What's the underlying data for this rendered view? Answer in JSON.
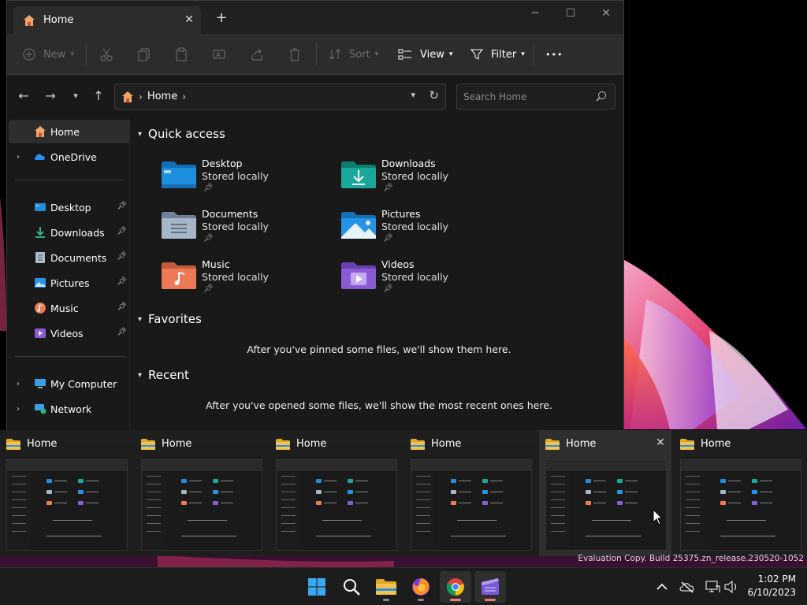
{
  "window": {
    "tab_title": "Home",
    "tab_add": "+",
    "tab_close": "✕",
    "minimize": "─",
    "maximize": "☐",
    "close": "✕"
  },
  "toolbar": {
    "new_label": "New",
    "sort_label": "Sort",
    "view_label": "View",
    "filter_label": "Filter",
    "more_label": "•••"
  },
  "address": {
    "location": "Home",
    "search_placeholder": "Search Home"
  },
  "sidebar": {
    "home": "Home",
    "onedrive": "OneDrive",
    "pinned": [
      {
        "label": "Desktop"
      },
      {
        "label": "Downloads"
      },
      {
        "label": "Documents"
      },
      {
        "label": "Pictures"
      },
      {
        "label": "Music"
      },
      {
        "label": "Videos"
      }
    ],
    "my_computer": "My Computer",
    "network": "Network"
  },
  "quick_access": {
    "heading": "Quick access",
    "items": [
      {
        "name": "Desktop",
        "sub": "Stored locally",
        "color": "#1e8fdd"
      },
      {
        "name": "Downloads",
        "sub": "Stored locally",
        "color": "#1aa89b"
      },
      {
        "name": "Documents",
        "sub": "Stored locally",
        "color": "#8ea3ba"
      },
      {
        "name": "Pictures",
        "sub": "Stored locally",
        "color": "#2593e6"
      },
      {
        "name": "Music",
        "sub": "Stored locally",
        "color": "#ec7a55"
      },
      {
        "name": "Videos",
        "sub": "Stored locally",
        "color": "#8b5bd6"
      }
    ]
  },
  "favorites": {
    "heading": "Favorites",
    "empty": "After you've pinned some files, we'll show them here."
  },
  "recent": {
    "heading": "Recent",
    "empty": "After you've opened some files, we'll show the most recent ones here."
  },
  "task_view": {
    "thumbnails": [
      {
        "title": "Home"
      },
      {
        "title": "Home"
      },
      {
        "title": "Home"
      },
      {
        "title": "Home"
      },
      {
        "title": "Home"
      },
      {
        "title": "Home"
      }
    ],
    "close": "✕"
  },
  "watermark": "Evaluation Copy. Build 25375.zn_release.230520-1052",
  "clock": {
    "time": "1:02 PM",
    "date": "6/10/2023"
  },
  "colors": {
    "accent": "#e8807a",
    "folder_yellow": "#f2c14e"
  }
}
